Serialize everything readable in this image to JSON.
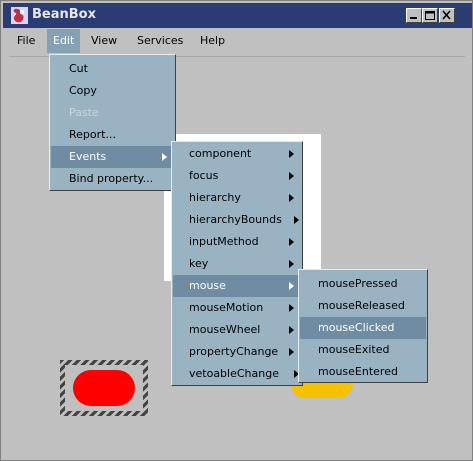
{
  "window": {
    "title": "BeanBox"
  },
  "menubar": {
    "items": [
      "File",
      "Edit",
      "View",
      "Services",
      "Help"
    ]
  },
  "edit_menu": {
    "items": [
      {
        "label": "Cut"
      },
      {
        "label": "Copy"
      },
      {
        "label": "Paste"
      },
      {
        "label": "Report..."
      },
      {
        "label": "Events"
      },
      {
        "label": "Bind property..."
      }
    ]
  },
  "events_menu": {
    "items": [
      {
        "label": "component"
      },
      {
        "label": "focus"
      },
      {
        "label": "hierarchy"
      },
      {
        "label": "hierarchyBounds"
      },
      {
        "label": "inputMethod"
      },
      {
        "label": "key"
      },
      {
        "label": "mouse"
      },
      {
        "label": "mouseMotion"
      },
      {
        "label": "mouseWheel"
      },
      {
        "label": "propertyChange"
      },
      {
        "label": "vetoableChange"
      }
    ]
  },
  "mouse_menu": {
    "items": [
      {
        "label": "mousePressed"
      },
      {
        "label": "mouseReleased"
      },
      {
        "label": "mouseClicked"
      },
      {
        "label": "mouseExited"
      },
      {
        "label": "mouseEntered"
      }
    ]
  },
  "state": {
    "active_menu": "Edit",
    "highlighted": [
      "Events",
      "mouse",
      "mouseClicked"
    ],
    "disabled": [
      "Paste"
    ]
  },
  "colors": {
    "title_bar": "#2b3c73",
    "menu_bg": "#99b3c3",
    "menu_highlight": "#6f8ca3",
    "canvas_bg": "#c0c0c0",
    "bean_red": "#ff0000",
    "bean_yellow": "#f6c000"
  }
}
